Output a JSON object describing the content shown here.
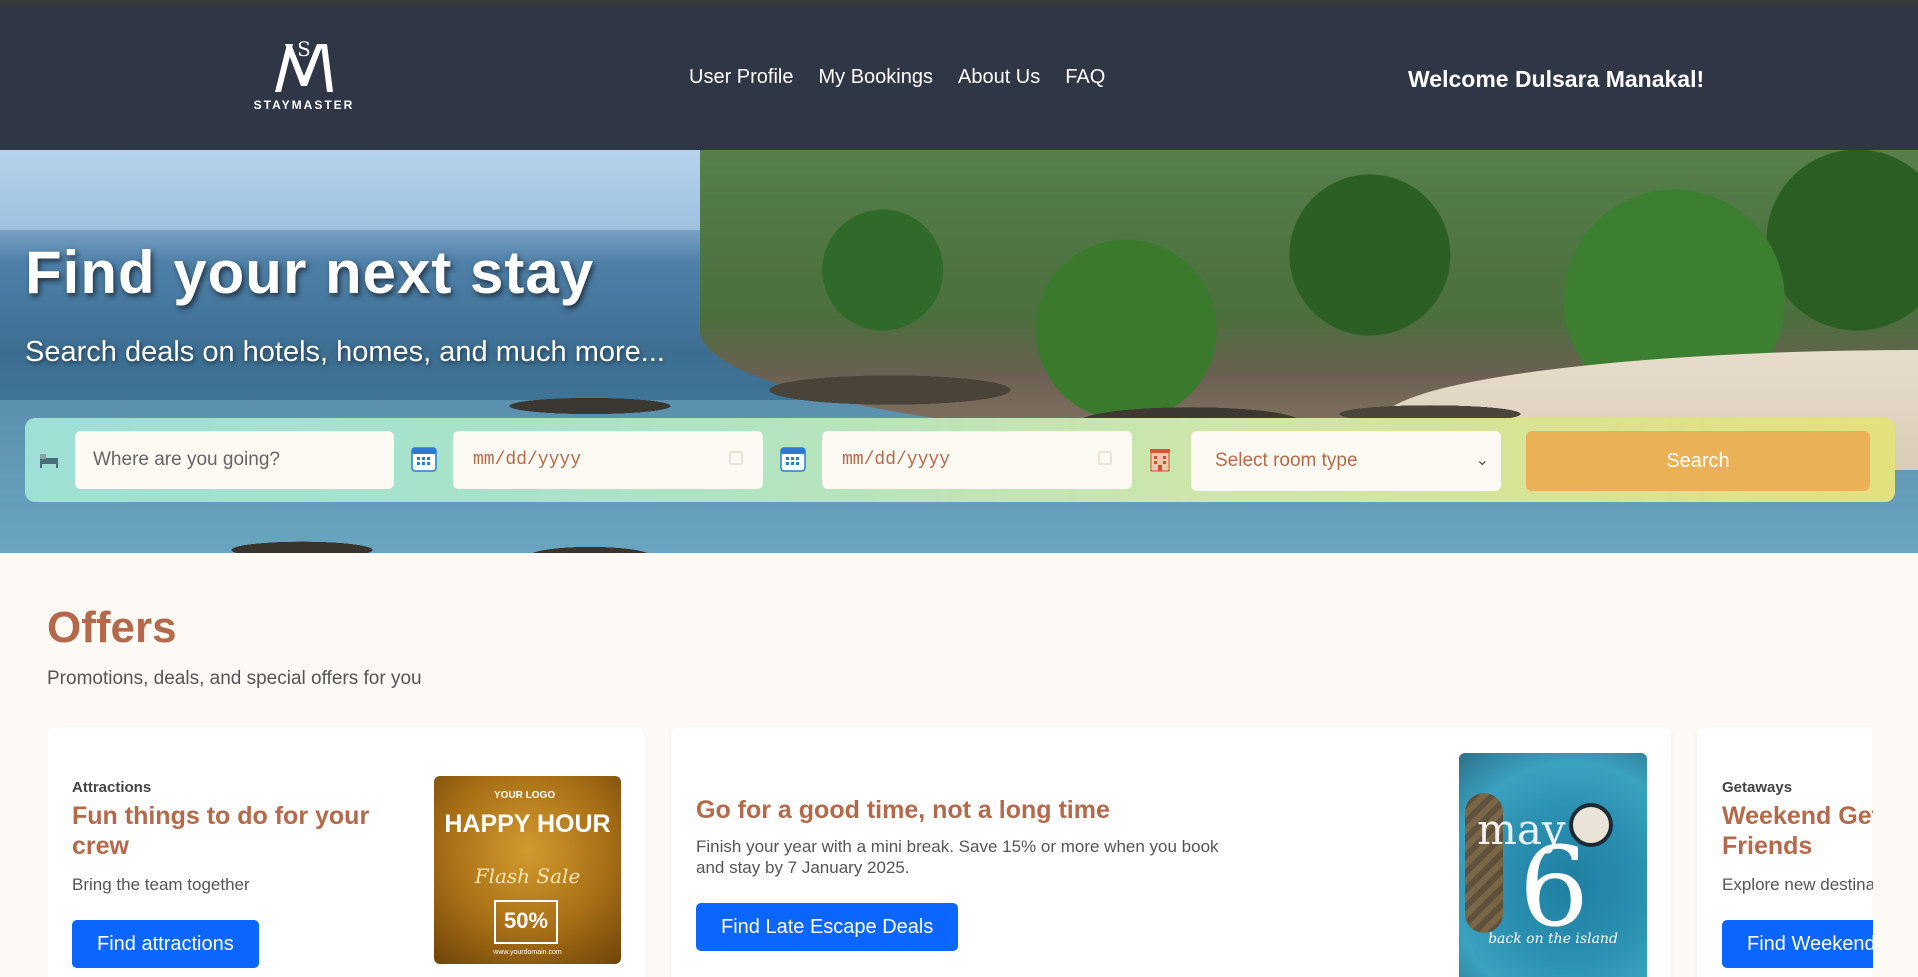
{
  "header": {
    "brand": "STAYMASTER",
    "logo_text": "STAY MASTER",
    "nav": [
      "User Profile",
      "My Bookings",
      "About Us",
      "FAQ"
    ],
    "welcome": "Welcome Dulsara Manakal!"
  },
  "hero": {
    "title": "Find your next stay",
    "subtitle": "Search deals on hotels, homes, and much more...",
    "search": {
      "destination_placeholder": "Where are you going?",
      "checkin": "mm/dd/yyyy",
      "checkout": "mm/dd/yyyy",
      "room_type": "Select room type",
      "search_label": "Search",
      "icons": [
        "bed-icon",
        "calendar-icon",
        "calendar-icon",
        "hotel-icon"
      ]
    }
  },
  "offers": {
    "title": "Offers",
    "subtitle": "Promotions, deals, and special offers for you",
    "cards": [
      {
        "tag": "Attractions",
        "title": "Fun things to do for your crew",
        "desc": "Bring the team together",
        "button": "Find attractions",
        "image": {
          "logo": "YOUR LOGO",
          "headline": "HAPPY HOUR",
          "script": "Flash Sale",
          "discount": "50%",
          "url": "www.yourdomain.com"
        }
      },
      {
        "tag": "",
        "title": "Go for a good time, not a long time",
        "desc": "Finish your year with a mini break. Save 15% or more when you book and stay by 7 January 2025.",
        "button": "Find Late Escape Deals",
        "image": {
          "word": "may",
          "number": "6",
          "tagline": "back on the island"
        }
      },
      {
        "tag": "Getaways",
        "title": "Weekend Getaways with Friends",
        "desc": "Explore new destinations",
        "button": "Find Weekend Deals"
      }
    ]
  },
  "colors": {
    "header_bg": "#2f3645",
    "accent_brown": "#b4694a",
    "button_blue": "#0a66ff",
    "search_button": "#ebb156"
  }
}
